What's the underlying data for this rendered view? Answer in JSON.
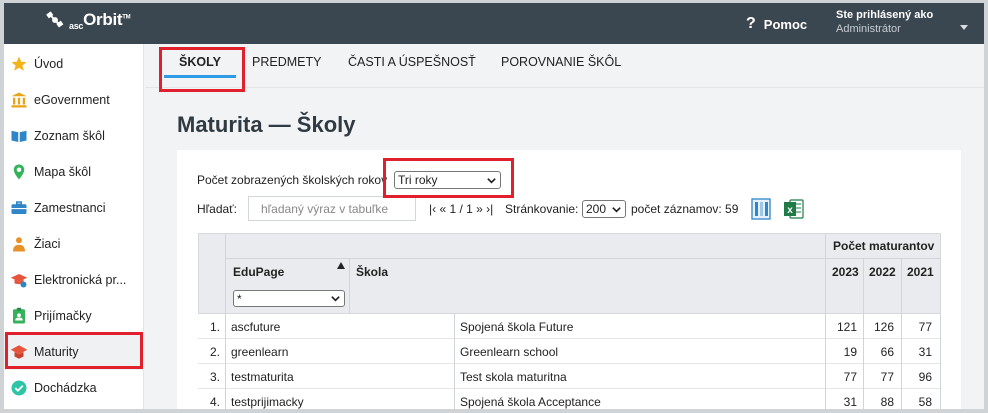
{
  "topbar": {
    "logo_main": "Orbit",
    "logo_prefix": "asc",
    "logo_tm": "TM",
    "help_icon": "?",
    "help_label": "Pomoc",
    "user_line1": "Ste prihlásený ako",
    "user_line2": "Administrátor"
  },
  "sidebar": {
    "items": [
      {
        "label": "Úvod",
        "icon": "star-icon"
      },
      {
        "label": "eGovernment",
        "icon": "government-building-icon"
      },
      {
        "label": "Zoznam škôl",
        "icon": "open-book-icon"
      },
      {
        "label": "Mapa škôl",
        "icon": "map-pin-icon"
      },
      {
        "label": "Zamestnanci",
        "icon": "briefcase-icon"
      },
      {
        "label": "Žiaci",
        "icon": "student-icon"
      },
      {
        "label": "Elektronická pr...",
        "icon": "graduation-cap-icon"
      },
      {
        "label": "Prijímačky",
        "icon": "clipboard-person-icon"
      },
      {
        "label": "Maturity",
        "icon": "graduation-hat-icon"
      },
      {
        "label": "Dochádzka",
        "icon": "check-circle-icon"
      }
    ]
  },
  "tabs": [
    "ŠKOLY",
    "PREDMETY",
    "ČASTI A ÚSPEŠNOSŤ",
    "POROVNANIE ŠKÔL"
  ],
  "page": {
    "title": "Maturita — Školy"
  },
  "filters": {
    "count_label": "Počet zobrazených školských rokov",
    "count_value": "Tri roky",
    "search_label": "Hľadať:",
    "search_placeholder": "hľadaný výraz v tabuľke",
    "pager_text": "|‹ « 1 / 1 » ›|",
    "paging_label": "Stránkovanie:",
    "paging_value": "200",
    "record_count": "počet záznamov: 59"
  },
  "table": {
    "group_header": "Počet maturantov",
    "col_edupage": "EduPage",
    "col_skola": "Škola",
    "edupage_filter": "*",
    "years": [
      "2023",
      "2022",
      "2021"
    ],
    "rows": [
      {
        "n": "1.",
        "edupage": "ascfuture",
        "skola": "Spojená škola Future",
        "y2023": "121",
        "y2022": "126",
        "y2021": "77"
      },
      {
        "n": "2.",
        "edupage": "greenlearn",
        "skola": "Greenlearn school",
        "y2023": "19",
        "y2022": "66",
        "y2021": "31"
      },
      {
        "n": "3.",
        "edupage": "testmaturita",
        "skola": "Test skola maturitna",
        "y2023": "77",
        "y2022": "77",
        "y2021": "96"
      },
      {
        "n": "4.",
        "edupage": "testprijimacky",
        "skola": "Spojená škola Acceptance",
        "y2023": "31",
        "y2022": "88",
        "y2021": "58"
      }
    ]
  },
  "colors": {
    "topbar": "#3b4750",
    "highlight": "#e0202c",
    "tab_underline": "#2f9be4"
  }
}
